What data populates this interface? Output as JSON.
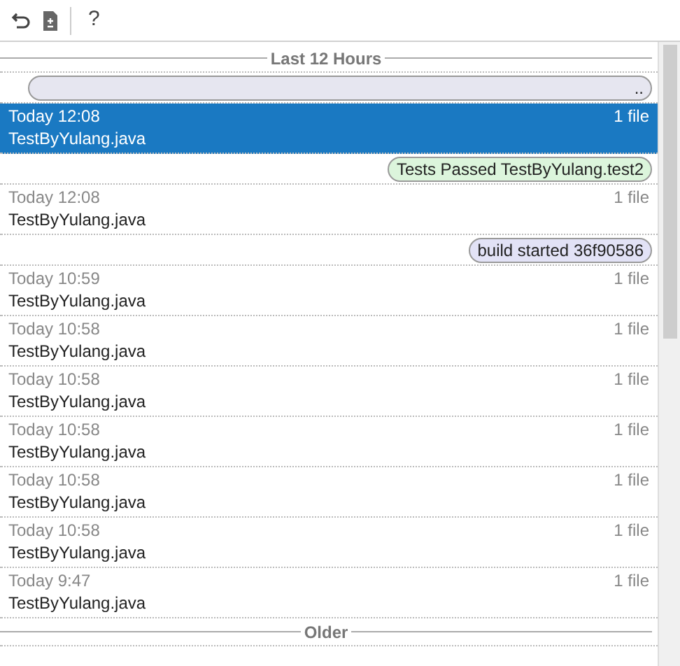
{
  "toolbar": {
    "help": "?"
  },
  "items": [
    {
      "kind": "header",
      "text": "Last 12 Hours"
    },
    {
      "kind": "label",
      "text": "..",
      "color": "#e6e6f0"
    },
    {
      "kind": "entry",
      "time": "Today 12:08",
      "file": "TestByYulang.java",
      "count": "1 file",
      "selected": true
    },
    {
      "kind": "label",
      "text": "Tests Passed TestByYulang.test2",
      "color": "#dcf5dc"
    },
    {
      "kind": "entry",
      "time": "Today 12:08",
      "file": "TestByYulang.java",
      "count": "1 file",
      "selected": false
    },
    {
      "kind": "label",
      "text": "build started 36f90586",
      "color": "#e2e2f6"
    },
    {
      "kind": "entry",
      "time": "Today 10:59",
      "file": "TestByYulang.java",
      "count": "1 file",
      "selected": false
    },
    {
      "kind": "entry",
      "time": "Today 10:58",
      "file": "TestByYulang.java",
      "count": "1 file",
      "selected": false
    },
    {
      "kind": "entry",
      "time": "Today 10:58",
      "file": "TestByYulang.java",
      "count": "1 file",
      "selected": false
    },
    {
      "kind": "entry",
      "time": "Today 10:58",
      "file": "TestByYulang.java",
      "count": "1 file",
      "selected": false
    },
    {
      "kind": "entry",
      "time": "Today 10:58",
      "file": "TestByYulang.java",
      "count": "1 file",
      "selected": false
    },
    {
      "kind": "entry",
      "time": "Today 10:58",
      "file": "TestByYulang.java",
      "count": "1 file",
      "selected": false
    },
    {
      "kind": "entry",
      "time": "Today 9:47",
      "file": "TestByYulang.java",
      "count": "1 file",
      "selected": false
    },
    {
      "kind": "header",
      "text": "Older"
    }
  ]
}
